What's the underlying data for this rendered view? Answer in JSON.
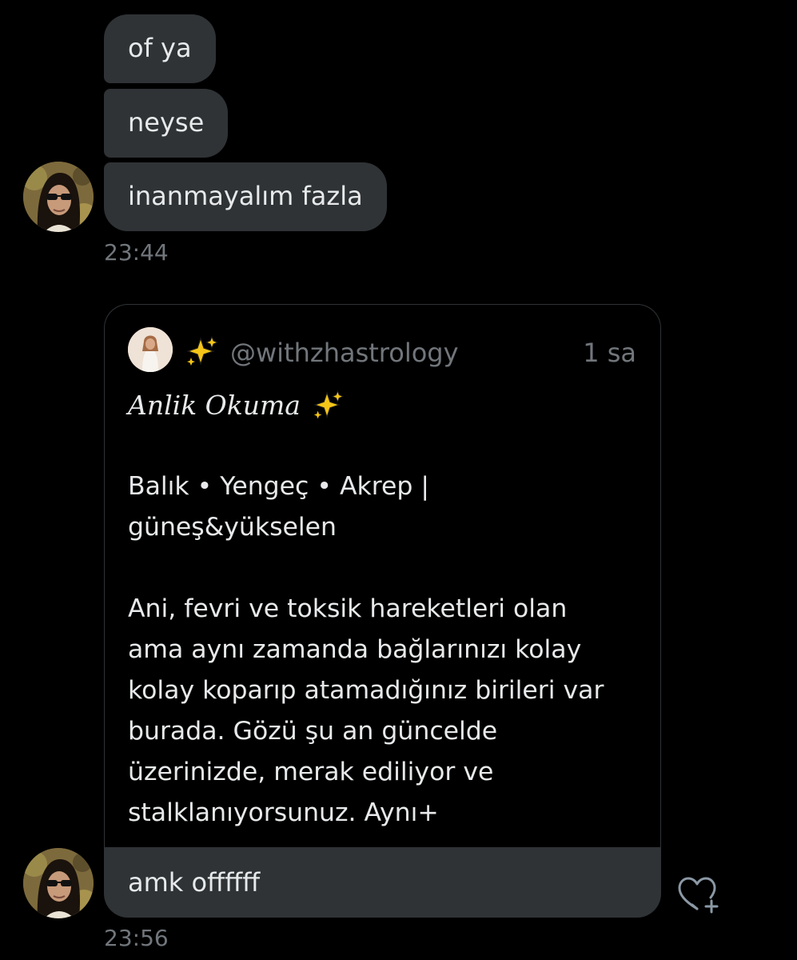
{
  "messages": [
    {
      "text": "of ya"
    },
    {
      "text": "neyse"
    },
    {
      "text": "inanmayalım fazla"
    }
  ],
  "timestamps": {
    "first_group": "23:44",
    "second_group": "23:56"
  },
  "shared_tweet": {
    "handle": "@withzhastrology",
    "time": "1 sa",
    "title": "Anlik Okuma",
    "lines_signs": [
      "Balık • Yengeç • Akrep |",
      "güneş&yükselen"
    ],
    "lines_body": [
      "Ani, fevri ve toksik hareketleri olan",
      "ama aynı zamanda bağlarınızı kolay",
      "kolay koparıp atamadığınız birileri var",
      "burada. Gözü şu an güncelde",
      "üzerinizde, merak ediliyor ve",
      "stalklanıyorsunuz. Aynı+"
    ]
  },
  "reply": {
    "text": "amk offffff"
  },
  "icons": {
    "sparkle": "sparkles-icon",
    "react": "heart-plus-icon"
  },
  "colors": {
    "background": "#000000",
    "bubble": "#2f3336",
    "text": "#e7e9ea",
    "muted": "#71767b",
    "sparkle": "#f5c518"
  }
}
